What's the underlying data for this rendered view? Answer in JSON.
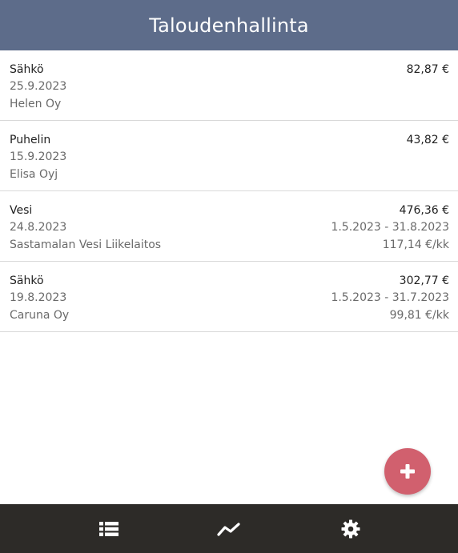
{
  "header": {
    "title": "Taloudenhallinta"
  },
  "bills": [
    {
      "title": "Sähkö",
      "amount": "82,87 €",
      "date": "25.9.2023",
      "period": "",
      "company": "Helen Oy",
      "monthly": ""
    },
    {
      "title": "Puhelin",
      "amount": "43,82 €",
      "date": "15.9.2023",
      "period": "",
      "company": "Elisa Oyj",
      "monthly": ""
    },
    {
      "title": "Vesi",
      "amount": "476,36 €",
      "date": "24.8.2023",
      "period": "1.5.2023 - 31.8.2023",
      "company": "Sastamalan Vesi Liikelaitos",
      "monthly": "117,14 €/kk"
    },
    {
      "title": "Sähkö",
      "amount": "302,77 €",
      "date": "19.8.2023",
      "period": "1.5.2023 - 31.7.2023",
      "company": "Caruna Oy",
      "monthly": "99,81 €/kk"
    }
  ],
  "fab": {
    "icon": "plus-icon",
    "color": "#d1606e"
  },
  "nav": {
    "items": [
      {
        "icon": "list-icon"
      },
      {
        "icon": "chart-line-icon"
      },
      {
        "icon": "gear-icon"
      }
    ]
  },
  "colors": {
    "header": "#5d6c8a",
    "nav": "#2d2b28",
    "accent": "#d1606e"
  }
}
